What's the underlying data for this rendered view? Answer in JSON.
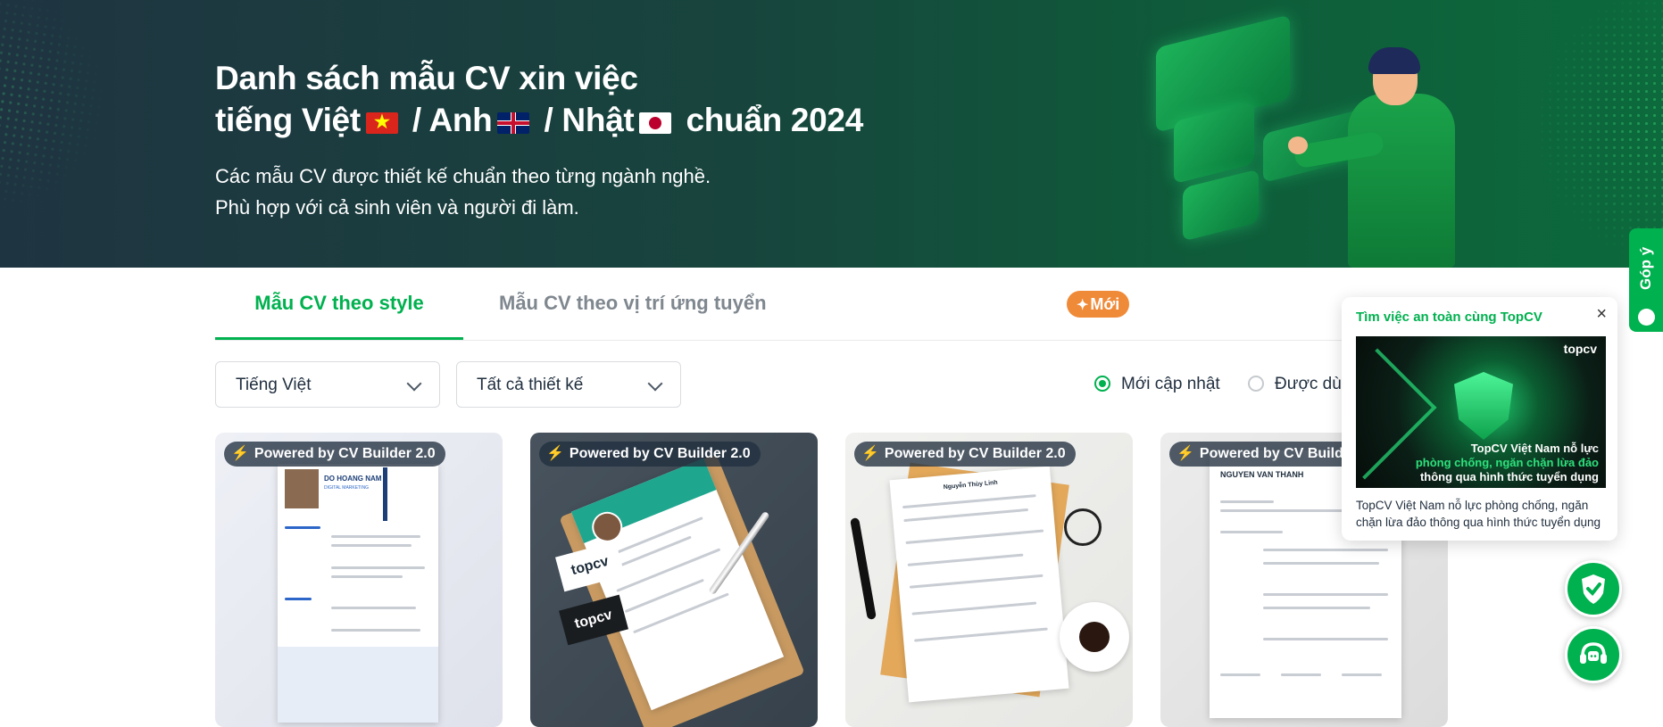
{
  "hero": {
    "title_line1": "Danh sách mẫu CV xin việc",
    "title_vi": "tiếng Việt",
    "sep1": "/",
    "title_en": "Anh",
    "sep2": "/",
    "title_jp": "Nhật",
    "title_year": "chuẩn 2024",
    "subtitle_line1": "Các mẫu CV được thiết kế chuẩn theo từng ngành nghề.",
    "subtitle_line2": "Phù hợp với cả sinh viên và người đi làm."
  },
  "tabs": [
    {
      "label": "Mẫu CV theo style",
      "active": true
    },
    {
      "label": "Mẫu CV theo vị trí ứng tuyển",
      "active": false,
      "badge": "Mới"
    }
  ],
  "filters": {
    "language": "Tiếng Việt",
    "design": "Tất cả thiết kế",
    "sort_options": [
      {
        "label": "Mới cập nhật",
        "selected": true
      },
      {
        "label": "Được dù",
        "selected": false
      }
    ]
  },
  "cards": [
    {
      "badge": "Powered by CV Builder 2.0",
      "name": "DO HOANG NAM",
      "role": "DIGITAL MARKETING"
    },
    {
      "badge": "Powered by CV Builder 2.0",
      "logo": "topcv"
    },
    {
      "badge": "Powered by CV Builder 2.0",
      "name": "Nguyễn Thùy Linh"
    },
    {
      "badge": "Powered by CV Builder 2.0",
      "name": "NGUYEN VAN THANH"
    }
  ],
  "promo": {
    "title": "Tìm việc an toàn cùng TopCV",
    "close": "×",
    "image_logo": "topcv",
    "image_line1": "TopCV Việt Nam nỗ lực",
    "image_line2": "phòng chống, ngăn chặn lừa đảo",
    "image_line3": "thông qua hình thức tuyển dụng",
    "description": "TopCV Việt Nam nỗ lực phòng chống, ngăn chặn lừa đảo thông qua hình thức tuyển dụng"
  },
  "feedback": {
    "label": "Góp ý"
  },
  "icons": {
    "shield_fab": "shield-check-icon",
    "support_fab": "headset-icon"
  },
  "colors": {
    "brand": "#00b14f",
    "badge_new": "#ef8a38",
    "hero_bg": "#17453d"
  }
}
